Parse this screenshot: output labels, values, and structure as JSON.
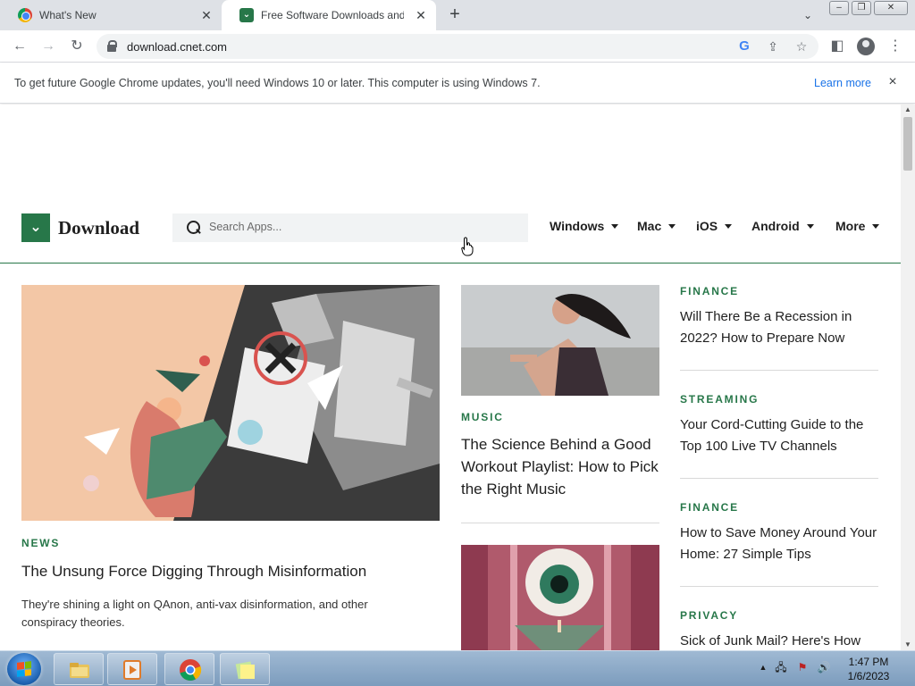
{
  "browser": {
    "tabs": [
      {
        "title": "What's New",
        "favicon": "chrome-icon",
        "active": false
      },
      {
        "title": "Free Software Downloads and Re",
        "favicon": "download-logo-icon",
        "active": true
      }
    ],
    "new_tab_label": "+",
    "url": "download.cnet.com"
  },
  "infobar": {
    "message": "To get future Google Chrome updates, you'll need Windows 10 or later. This computer is using Windows 7.",
    "learn_more": "Learn more",
    "close": "×"
  },
  "site": {
    "brand": "Download",
    "brand_color": "#277749",
    "search_placeholder": "Search Apps...",
    "nav": [
      "Windows",
      "Mac",
      "iOS",
      "Android",
      "More"
    ]
  },
  "articles": {
    "feature": {
      "category": "NEWS",
      "title": "The Unsung Force Digging Through Misinformation",
      "summary": "They're shining a light on QAnon, anti-vax disinformation, and other conspiracy theories."
    },
    "middle": [
      {
        "category": "MUSIC",
        "title": "The Science Behind a Good Workout Playlist: How to Pick the Right Music"
      }
    ],
    "right": [
      {
        "category": "FINANCE",
        "title": "Will There Be a Recession in 2022? How to Prepare Now"
      },
      {
        "category": "STREAMING",
        "title": "Your Cord-Cutting Guide to the Top 100 Live TV Channels"
      },
      {
        "category": "FINANCE",
        "title": "How to Save Money Around Your Home: 27 Simple Tips"
      },
      {
        "category": "PRIVACY",
        "title": "Sick of Junk Mail? Here's How"
      }
    ]
  },
  "taskbar": {
    "time": "1:47 PM",
    "date": "1/6/2023"
  }
}
